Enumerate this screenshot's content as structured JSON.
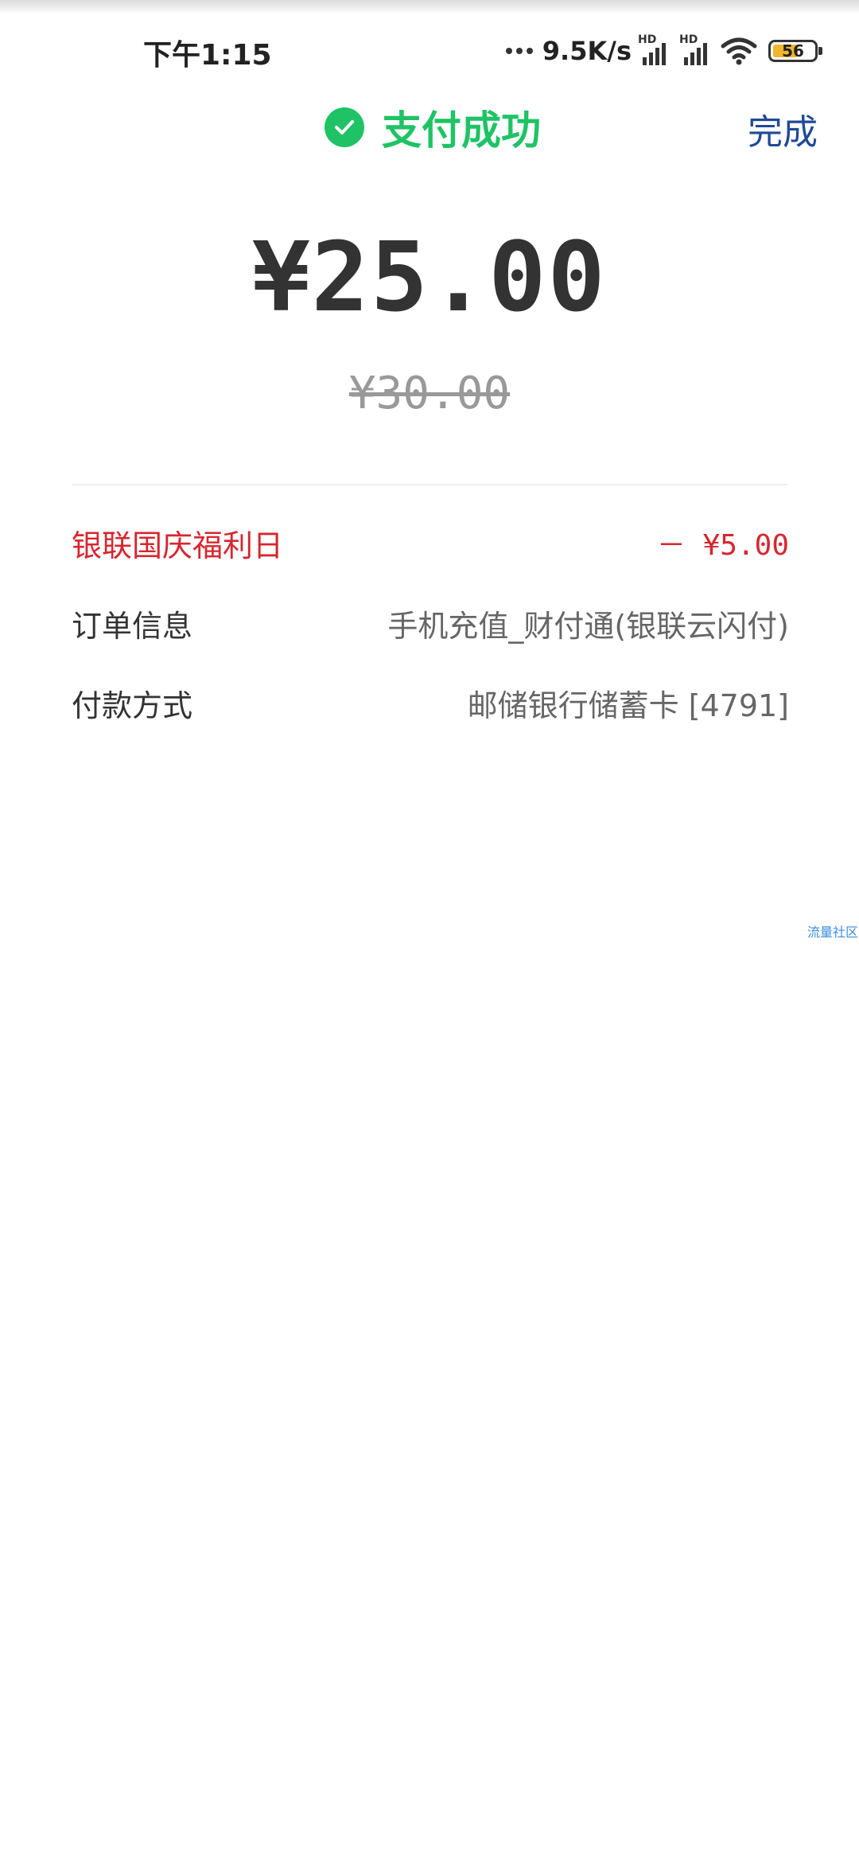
{
  "status_bar": {
    "time": "下午1:15",
    "network_speed": "9.5K/s",
    "signal_label_1": "HD",
    "signal_label_2": "HD",
    "battery_level": "56",
    "battery_fraction": 0.56
  },
  "header": {
    "title": "支付成功",
    "done_label": "完成",
    "accent_color": "#1fc365"
  },
  "payment": {
    "amount": "¥25.00",
    "original_amount": "¥30.00"
  },
  "details": {
    "discount": {
      "label": "银联国庆福利日",
      "value": "－ ¥5.00"
    },
    "order": {
      "label": "订单信息",
      "value": "手机充值_财付通(银联云闪付)"
    },
    "payment_method": {
      "label": "付款方式",
      "value": "邮储银行储蓄卡 [4791]"
    }
  },
  "watermark": "流量社区"
}
